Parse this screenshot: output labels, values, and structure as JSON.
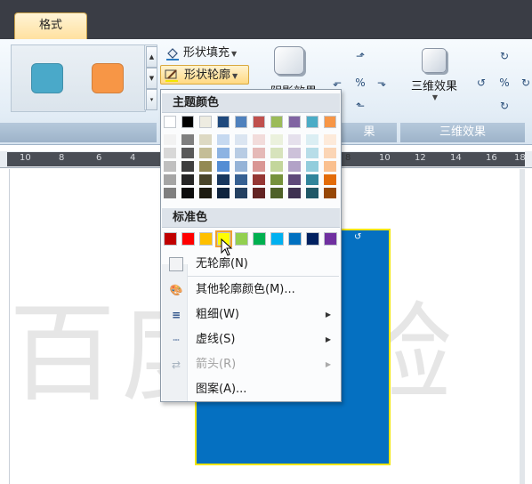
{
  "tabs": {
    "format_label": "格式"
  },
  "ribbon": {
    "style_swatches": [
      "#4aa9c9",
      "#f79646"
    ],
    "shape_fill_label": "形状填充",
    "shape_outline_label": "形状轮廓",
    "shadow_effect_label": "阴影效果",
    "three_d_label": "三维效果",
    "group_shadow_label": "果",
    "group_3d_label": "三维效果"
  },
  "ruler": {
    "left_ticks": [
      "10",
      "8",
      "6",
      "4"
    ],
    "right_ticks": [
      "8",
      "10",
      "12",
      "14",
      "16",
      "18"
    ]
  },
  "document": {
    "watermark_text": "百度经验",
    "shape_fill_color": "#0570c1",
    "shape_outline_color": "#f2e600"
  },
  "outline_menu": {
    "theme_colors_header": "主题颜色",
    "theme_colors": [
      "#ffffff",
      "#000000",
      "#eeece1",
      "#1f497d",
      "#4f81bd",
      "#c0504d",
      "#9bbb59",
      "#8064a2",
      "#4bacc6",
      "#f79646"
    ],
    "theme_shades": [
      [
        "#f2f2f2",
        "#d8d8d8",
        "#bfbfbf",
        "#a5a5a5",
        "#7f7f7f"
      ],
      [
        "#7f7f7f",
        "#595959",
        "#3f3f3f",
        "#262626",
        "#0c0c0c"
      ],
      [
        "#ddd9c3",
        "#c4bd97",
        "#938953",
        "#494429",
        "#1d1b10"
      ],
      [
        "#c6d9f0",
        "#8db3e2",
        "#548dd4",
        "#17365d",
        "#0f243e"
      ],
      [
        "#dbe5f1",
        "#b8cce4",
        "#95b3d7",
        "#366092",
        "#244061"
      ],
      [
        "#f2dcdb",
        "#e5b9b7",
        "#d99694",
        "#953734",
        "#632423"
      ],
      [
        "#ebf1dd",
        "#d7e3bc",
        "#c3d69b",
        "#76923c",
        "#4f6128"
      ],
      [
        "#e5e0ec",
        "#ccc1d9",
        "#b2a2c7",
        "#5f497a",
        "#3f3151"
      ],
      [
        "#dbeef3",
        "#b7dde8",
        "#92cddc",
        "#31859b",
        "#205867"
      ],
      [
        "#fdeada",
        "#fbd5b5",
        "#fac08f",
        "#e36c09",
        "#974806"
      ]
    ],
    "standard_colors_header": "标准色",
    "standard_colors": [
      "#c00000",
      "#ff0000",
      "#ffc000",
      "#ffff00",
      "#92d050",
      "#00b050",
      "#00b0f0",
      "#0070c0",
      "#002060",
      "#7030a0"
    ],
    "selected_standard_color": "#ffff00",
    "items": {
      "no_outline": "无轮廓(N)",
      "more_colors": "其他轮廓颜色(M)...",
      "weight": "粗细(W)",
      "dashes": "虚线(S)",
      "arrows": "箭头(R)",
      "pattern": "图案(A)..."
    }
  }
}
